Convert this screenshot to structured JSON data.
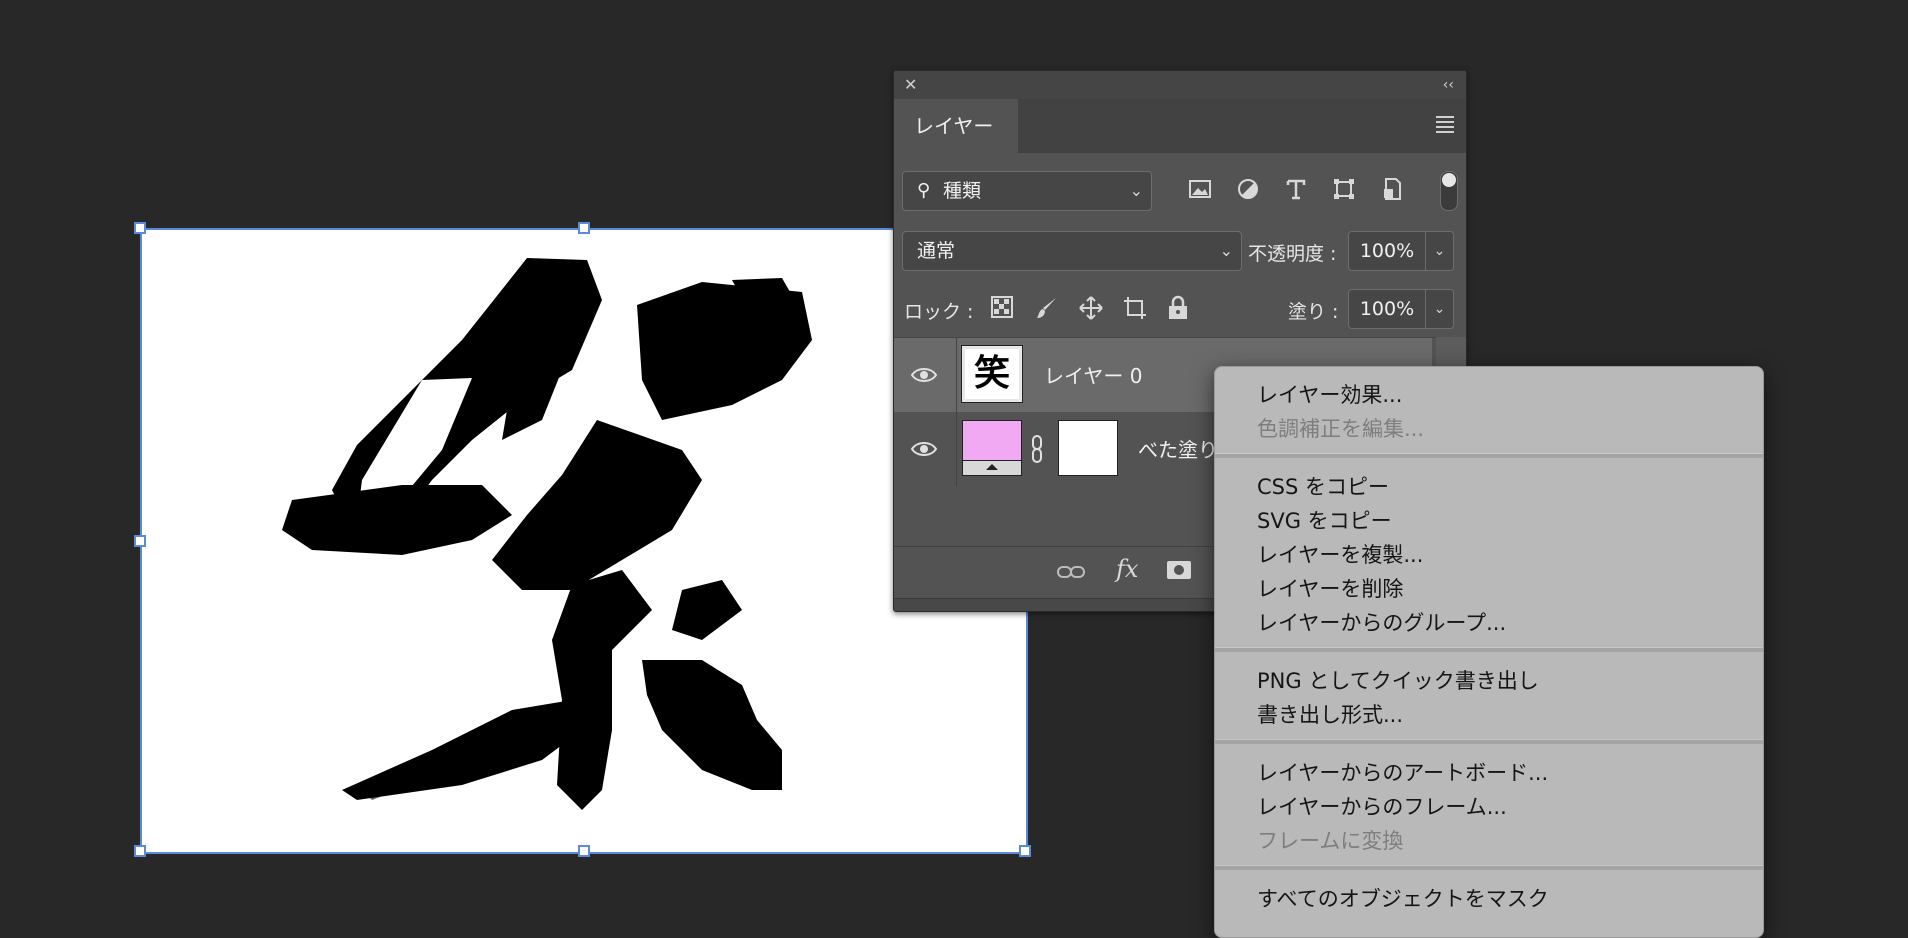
{
  "canvas": {
    "glyph": "笑"
  },
  "panel": {
    "close_icon": "close-icon",
    "collapse_icon": "double-chevron-left-icon",
    "tab_label": "レイヤー",
    "filter": {
      "kind_label": "種類"
    },
    "blend_mode": "通常",
    "opacity_label": "不透明度 :",
    "opacity_value": "100%",
    "lock_label": "ロック :",
    "fill_label": "塗り :",
    "fill_value": "100%",
    "layers": [
      {
        "name": "レイヤー 0",
        "visible": true,
        "selected": true
      },
      {
        "name": "べた塗り",
        "visible": true,
        "selected": false,
        "fill_color": "#f2a9f3"
      }
    ],
    "bottom_fx": "fx"
  },
  "context_menu": {
    "items": [
      {
        "label": "レイヤー効果...",
        "enabled": true
      },
      {
        "label": "色調補正を編集...",
        "enabled": false
      },
      {
        "separator": true
      },
      {
        "label": "CSS をコピー",
        "enabled": true
      },
      {
        "label": "SVG をコピー",
        "enabled": true
      },
      {
        "label": "レイヤーを複製...",
        "enabled": true
      },
      {
        "label": "レイヤーを削除",
        "enabled": true
      },
      {
        "label": "レイヤーからのグループ...",
        "enabled": true
      },
      {
        "separator": true
      },
      {
        "label": "PNG としてクイック書き出し",
        "enabled": true
      },
      {
        "label": "書き出し形式...",
        "enabled": true
      },
      {
        "separator": true
      },
      {
        "label": "レイヤーからのアートボード...",
        "enabled": true
      },
      {
        "label": "レイヤーからのフレーム...",
        "enabled": true
      },
      {
        "label": "フレームに変換",
        "enabled": false
      },
      {
        "separator": true
      },
      {
        "label": "すべてのオブジェクトをマスク",
        "enabled": true
      }
    ]
  },
  "colors": {
    "background": "#282828",
    "panel": "#535353",
    "selection": "#5b8bd6",
    "menu": "#b9b9b9"
  }
}
